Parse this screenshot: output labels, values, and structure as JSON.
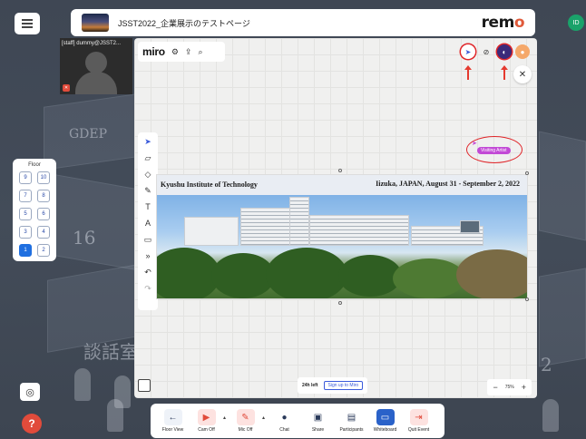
{
  "header": {
    "event_title": "JSST2022_企業展示のテストページ",
    "brand_logo": "remo",
    "user_initials": "ID"
  },
  "video": {
    "participant_name": "[staff] dummy@JSST2..."
  },
  "floor_panel": {
    "title": "Floor",
    "floors": [
      "9",
      "10",
      "7",
      "8",
      "5",
      "6",
      "3",
      "4",
      "1",
      "2"
    ],
    "active_floor": "1"
  },
  "background": {
    "label_gdep": "GDEP",
    "label_16": "16",
    "label_room": "談話室",
    "label_2": "2"
  },
  "miro": {
    "logo": "miro",
    "close_label": "✕",
    "visiting_label": "Visiting Artist",
    "time_left": "24h left",
    "signup_label": "Sign up to Miro",
    "zoom_level": "75%",
    "zoom_minus": "−",
    "zoom_plus": "+"
  },
  "banner": {
    "left_text": "Kyushu Institute of Technology",
    "right_text": "Iizuka, JAPAN, August 31 - September 2, 2022"
  },
  "bottom_bar": {
    "items": [
      {
        "label": "Floor View",
        "icon": "arrow-left-icon"
      },
      {
        "label": "Cam Off",
        "icon": "camera-off-icon"
      },
      {
        "label": "Mic Off",
        "icon": "mic-off-icon"
      },
      {
        "label": "Chat",
        "icon": "chat-icon"
      },
      {
        "label": "Share",
        "icon": "screen-share-icon"
      },
      {
        "label": "Participants",
        "icon": "participants-icon"
      },
      {
        "label": "Whiteboard",
        "icon": "whiteboard-icon"
      },
      {
        "label": "Quit Event",
        "icon": "exit-icon"
      }
    ]
  },
  "colors": {
    "accent_red": "#e14b3b",
    "floor_active": "#1f6fe0",
    "annotation_red": "#e0262a",
    "visiting_tag": "#c24ad6"
  }
}
